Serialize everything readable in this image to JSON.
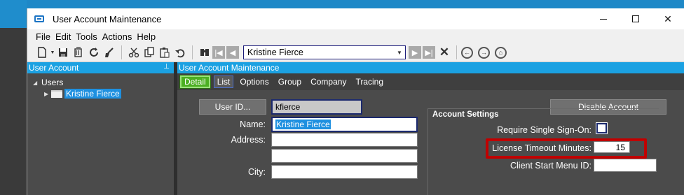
{
  "window": {
    "title": "User Account Maintenance",
    "controls": {
      "minimize": "",
      "maximize": "",
      "close": "✕"
    }
  },
  "menu": [
    "File",
    "Edit",
    "Tools",
    "Actions",
    "Help"
  ],
  "toolbar": {
    "record_combo_value": "Kristine Fierce",
    "icons": [
      "new-icon",
      "save-icon",
      "delete-icon",
      "refresh-icon",
      "clear-icon",
      "cut-icon",
      "copy-icon",
      "paste-icon",
      "undo-icon",
      "search-icon",
      "first-icon",
      "prev-icon",
      "next-icon",
      "last-icon",
      "close-icon",
      "back-icon",
      "forward-icon",
      "home-icon"
    ]
  },
  "left_pane": {
    "header": "User Account",
    "tree": {
      "root": "Users",
      "child": "Kristine Fierce"
    }
  },
  "right_pane": {
    "header": "User Account Maintenance",
    "tabs": [
      "Detail",
      "List",
      "Options",
      "Group",
      "Company",
      "Tracing"
    ],
    "active_tab": "Detail"
  },
  "form": {
    "user_id_button": "User ID...",
    "user_id_value": "kfierce",
    "disable_button": "Disable Account",
    "name_label": "Name:",
    "name_value": "Kristine Fierce",
    "address_label": "Address:",
    "address_value_1": "",
    "address_value_2": "",
    "city_label": "City:",
    "city_value": "",
    "account_settings": {
      "title": "Account Settings",
      "require_sso_label": "Require Single Sign-On:",
      "require_sso_checked": false,
      "license_timeout_label": "License Timeout Minutes:",
      "license_timeout_value": "15",
      "client_start_menu_label": "Client Start Menu ID:",
      "client_start_menu_value": ""
    }
  },
  "colors": {
    "accent": "#1ba1e2",
    "pane_bg": "#4b4b4b",
    "highlight": "#c00000",
    "active_tab": "#4caf22"
  }
}
